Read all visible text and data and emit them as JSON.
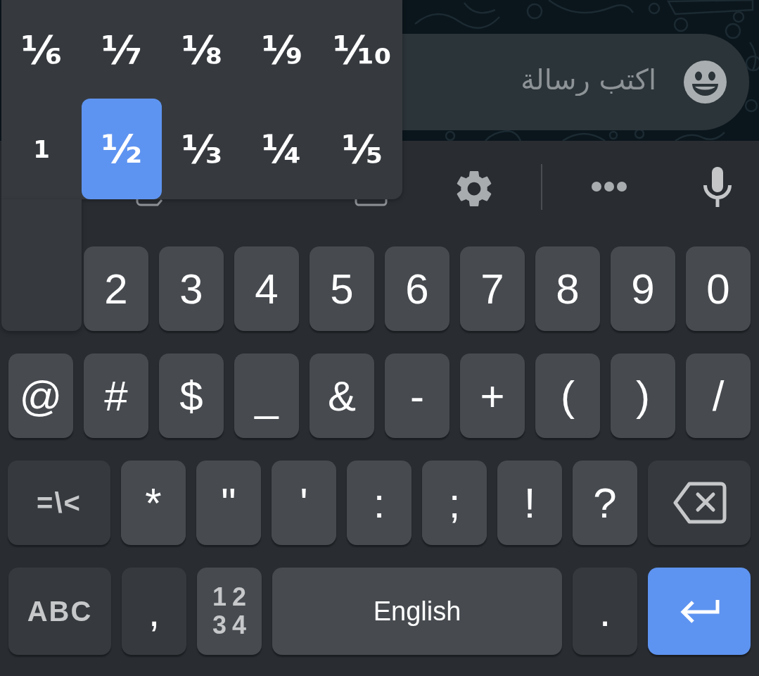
{
  "chat": {
    "message_field": {
      "placeholder": "اكتب رسالة"
    }
  },
  "popup": {
    "rows": [
      [
        {
          "label": "⅙",
          "kind": "fraction",
          "selected": false
        },
        {
          "label": "⅐",
          "kind": "fraction",
          "selected": false
        },
        {
          "label": "⅛",
          "kind": "fraction",
          "selected": false
        },
        {
          "label": "⅑",
          "kind": "fraction",
          "selected": false
        },
        {
          "label": "⅒",
          "kind": "fraction",
          "selected": false
        }
      ],
      [
        {
          "label": "1",
          "kind": "digit",
          "selected": false
        },
        {
          "label": "½",
          "kind": "fraction",
          "selected": true
        },
        {
          "label": "⅓",
          "kind": "fraction",
          "selected": false
        },
        {
          "label": "¼",
          "kind": "fraction",
          "selected": false
        },
        {
          "label": "⅕",
          "kind": "fraction",
          "selected": false
        }
      ]
    ]
  },
  "keyboard": {
    "number_row": [
      {
        "label": "2",
        "kind": "number"
      },
      {
        "label": "3",
        "kind": "number"
      },
      {
        "label": "4",
        "kind": "number"
      },
      {
        "label": "5",
        "kind": "number"
      },
      {
        "label": "6",
        "kind": "number"
      },
      {
        "label": "7",
        "kind": "number"
      },
      {
        "label": "8",
        "kind": "number"
      },
      {
        "label": "9",
        "kind": "number"
      },
      {
        "label": "0",
        "kind": "number"
      }
    ],
    "symbol_row": [
      {
        "label": "@",
        "kind": "symbol"
      },
      {
        "label": "#",
        "kind": "symbol"
      },
      {
        "label": "$",
        "kind": "symbol"
      },
      {
        "label": "_",
        "kind": "symbol"
      },
      {
        "label": "&",
        "kind": "symbol"
      },
      {
        "label": "-",
        "kind": "symbol"
      },
      {
        "label": "+",
        "kind": "symbol"
      },
      {
        "label": "(",
        "kind": "symbol"
      },
      {
        "label": ")",
        "kind": "symbol"
      },
      {
        "label": "/",
        "kind": "symbol"
      }
    ],
    "punctuation_row": [
      {
        "label": "=\\<",
        "kind": "mode"
      },
      {
        "label": "*",
        "kind": "symbol"
      },
      {
        "label": "\"",
        "kind": "symbol"
      },
      {
        "label": "'",
        "kind": "symbol"
      },
      {
        "label": ":",
        "kind": "symbol"
      },
      {
        "label": ";",
        "kind": "symbol"
      },
      {
        "label": "!",
        "kind": "symbol"
      },
      {
        "label": "?",
        "kind": "symbol"
      },
      {
        "kind": "backspace"
      }
    ],
    "bottom_row": [
      {
        "label": "ABC",
        "kind": "mode"
      },
      {
        "label": ",",
        "kind": "punct"
      },
      {
        "lines": [
          "12",
          "34"
        ],
        "kind": "numpad"
      },
      {
        "label": "English",
        "kind": "space"
      },
      {
        "label": ".",
        "kind": "punct"
      },
      {
        "kind": "enter"
      }
    ]
  }
}
